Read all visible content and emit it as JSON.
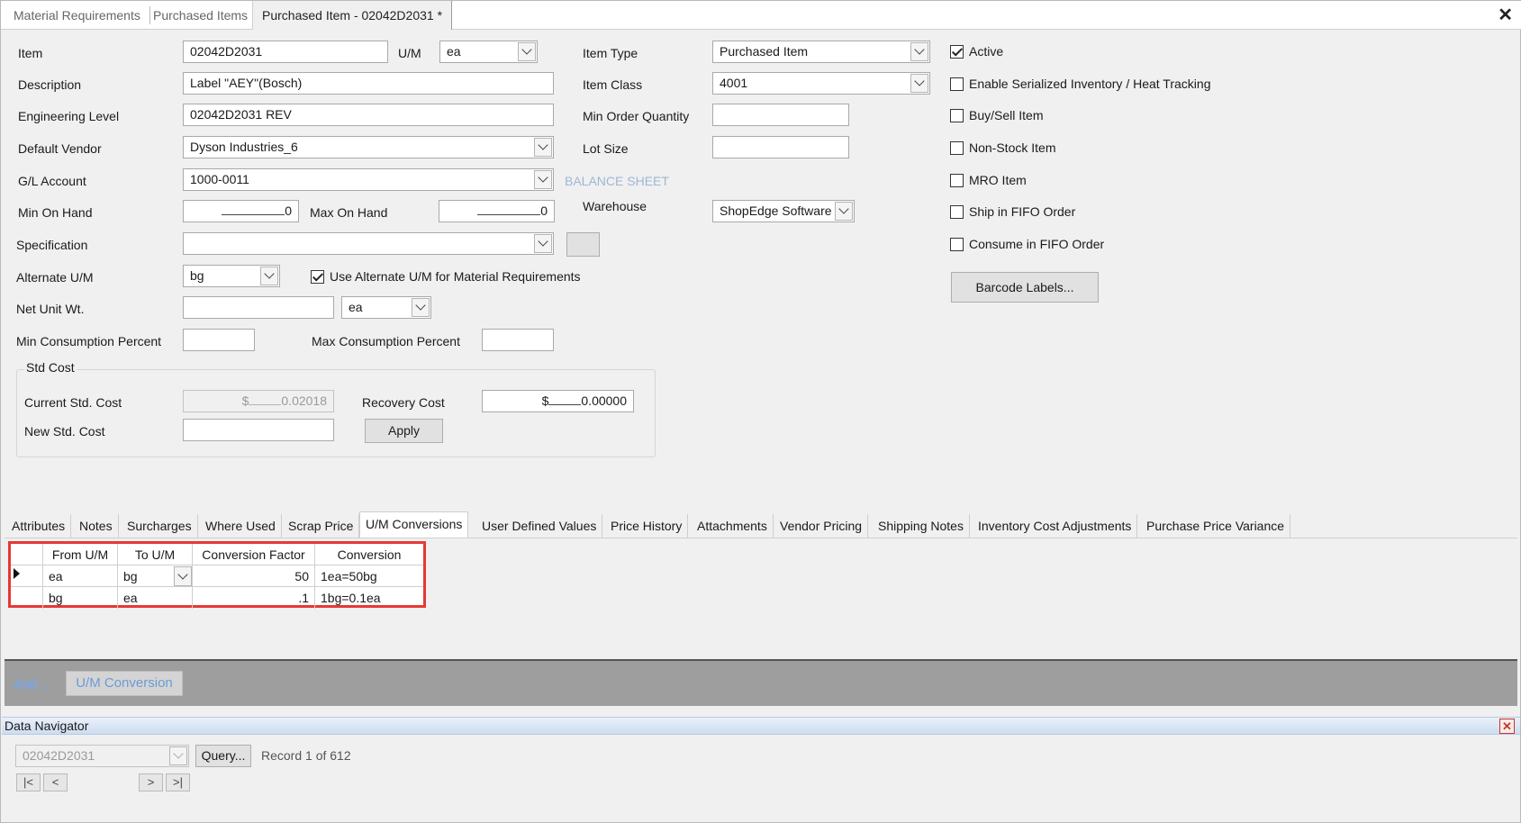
{
  "doc_tabs": [
    "Material Requirements",
    "Purchased Items",
    "Purchased Item - 02042D2031 *"
  ],
  "form": {
    "item_label": "Item",
    "item_value": "02042D2031",
    "um_label": "U/M",
    "um_value": "ea",
    "description_label": "Description",
    "description_value": "Label \"AEY\"(Bosch)",
    "eng_level_label": "Engineering Level",
    "eng_level_value": "02042D2031 REV",
    "default_vendor_label": "Default Vendor",
    "default_vendor_value": "Dyson Industries_6",
    "gl_account_label": "G/L Account",
    "gl_account_value": "1000-0011",
    "gl_account_type": "BALANCE SHEET",
    "min_on_hand_label": "Min On Hand",
    "min_on_hand_value": "0",
    "max_on_hand_label": "Max On Hand",
    "max_on_hand_value": "0",
    "specification_label": "Specification",
    "specification_value": "",
    "alt_um_label": "Alternate U/M",
    "alt_um_value": "bg",
    "use_alt_um_label": "Use Alternate U/M for Material Requirements",
    "net_unit_wt_label": "Net Unit Wt.",
    "net_unit_wt_value": "",
    "net_unit_um": "ea",
    "min_consumption_label": "Min Consumption Percent",
    "min_consumption_value": "",
    "max_consumption_label": "Max Consumption Percent",
    "max_consumption_value": "",
    "item_type_label": "Item Type",
    "item_type_value": "Purchased Item",
    "item_class_label": "Item Class",
    "item_class_value": "4001",
    "min_order_qty_label": "Min Order Quantity",
    "min_order_qty_value": "",
    "lot_size_label": "Lot Size",
    "lot_size_value": "",
    "warehouse_label": "Warehouse",
    "warehouse_value": "ShopEdge Software"
  },
  "std_cost": {
    "group_label": "Std Cost",
    "current_label": "Current Std. Cost",
    "current_prefix": "$",
    "current_value": "0.02018",
    "recovery_label": "Recovery Cost",
    "recovery_prefix": "$",
    "recovery_value": "0.00000",
    "new_label": "New Std. Cost",
    "new_value": "",
    "apply_label": "Apply"
  },
  "checkboxes": [
    {
      "label": "Active",
      "checked": true
    },
    {
      "label": "Enable Serialized Inventory / Heat Tracking",
      "checked": false
    },
    {
      "label": "Buy/Sell Item",
      "checked": false
    },
    {
      "label": "Non-Stock Item",
      "checked": false
    },
    {
      "label": "MRO Item",
      "checked": false
    },
    {
      "label": "Ship in FIFO Order",
      "checked": false
    },
    {
      "label": "Consume in FIFO Order",
      "checked": false
    }
  ],
  "barcode_button": "Barcode Labels...",
  "detail_tabs": [
    "Attributes",
    "Notes",
    "Surcharges",
    "Where Used",
    "Scrap Price",
    "U/M Conversions",
    "User Defined Values",
    "Price History",
    "Attachments",
    "Vendor Pricing",
    "Shipping Notes",
    "Inventory Cost Adjustments",
    "Purchase Price Variance"
  ],
  "active_tab": "U/M Conversions",
  "um_grid": {
    "columns": [
      "From U/M",
      "To U/M",
      "Conversion Factor",
      "Conversion"
    ],
    "rows": [
      [
        "ea",
        "bg",
        "50",
        "1ea=50bg"
      ],
      [
        "bg",
        "ea",
        ".1",
        "1bg=0.1ea"
      ]
    ]
  },
  "add_bar": {
    "add_label": "Add ...",
    "um_button": "U/M Conversion"
  },
  "navigator": {
    "title": "Data Navigator",
    "record_value": "02042D2031",
    "query_label": "Query...",
    "record_info": "Record 1 of 612",
    "buttons": [
      "|<",
      "<",
      ">",
      ">|"
    ]
  },
  "colors": {
    "highlight": "#e53935",
    "link": "#6ea8ff",
    "balance_sheet": "#9fb7d3"
  }
}
